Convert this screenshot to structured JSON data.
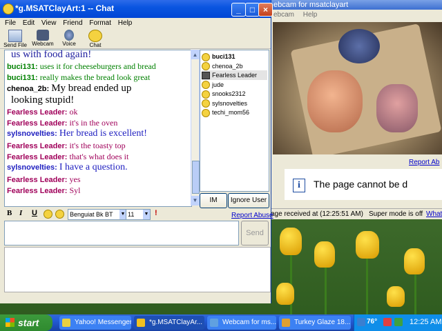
{
  "chat_window": {
    "title": "*g.MSATClayArt:1 -- Chat",
    "menu": [
      "File",
      "Edit",
      "View",
      "Friend",
      "Format",
      "Help"
    ],
    "toolbar": [
      "Send File",
      "Webcam",
      "Voice",
      "Chat"
    ],
    "messages": [
      {
        "name": "",
        "text": "us with food again!",
        "color": "#2020a0"
      },
      {
        "name": "buci131:",
        "text": "uses it for cheeseburgers and bread",
        "color": "#008000"
      },
      {
        "name": "buci131:",
        "text": "really makes the bread look great",
        "color": "#008000"
      },
      {
        "name": "chenoa_2b:",
        "text": "My bread ended up",
        "color": "#000000"
      },
      {
        "name": "",
        "text": "looking stupid!",
        "color": "#000000"
      },
      {
        "name": "Fearless Leader:",
        "text": "ok",
        "color": "#a0005a"
      },
      {
        "name": "Fearless Leader:",
        "text": "it's in the oven",
        "color": "#a0005a"
      },
      {
        "name": "sylsnovelties:",
        "text": "Her bread is excellent!",
        "color": "#2020c0"
      },
      {
        "name": "Fearless Leader:",
        "text": "it's the toasty top",
        "color": "#a0005a"
      },
      {
        "name": "Fearless Leader:",
        "text": "that's what does it",
        "color": "#a0005a"
      },
      {
        "name": "sylsnovelties:",
        "text": "I have a question.",
        "color": "#2020c0"
      },
      {
        "name": "Fearless Leader:",
        "text": "yes",
        "color": "#a0005a"
      },
      {
        "name": "Fearless Leader:",
        "text": "Syl",
        "color": "#a0005a"
      }
    ],
    "buddies": [
      "buci131",
      "chenoa_2b",
      "Fearless Leader",
      "jude",
      "snooks2312",
      "sylsnovelties",
      "techi_mom56"
    ],
    "im_button": "IM",
    "ignore_button": "Ignore User",
    "font_name": "Benguiat Bk BT",
    "font_size": "11",
    "report_abuse": "Report Abuse",
    "send": "Send"
  },
  "webcam_window": {
    "title": "ebcam for msatclayart",
    "menu": [
      "ebcam",
      "Help"
    ],
    "report": "Report Ab",
    "error": "The page cannot be d",
    "status_received": "age received at (12:25:51 AM)",
    "status_super": "Super mode is off",
    "status_link": "What's t"
  },
  "taskbar": {
    "start": "start",
    "tasks": [
      {
        "label": "Yahoo! Messenger",
        "color": "#e8d040"
      },
      {
        "label": "*g.MSATClayAr...",
        "color": "#f0c020"
      },
      {
        "label": "Webcam for ms...",
        "color": "#60a0e0"
      },
      {
        "label": "Turkey Glaze 18...",
        "color": "#e0a030"
      }
    ],
    "temp": "76°",
    "clock": "12:25 AM"
  }
}
